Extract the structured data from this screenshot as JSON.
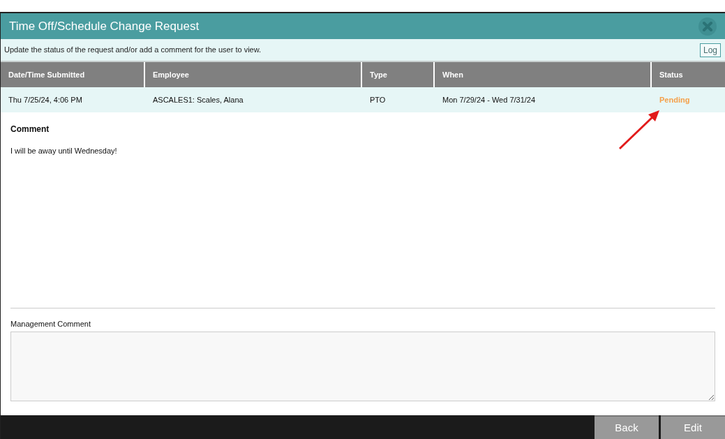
{
  "window": {
    "title": "Time Off/Schedule Change Request"
  },
  "instructions": "Update the status of the request and/or add a comment for the user to view.",
  "log_button": "Log",
  "table": {
    "columns": [
      "Date/Time Submitted",
      "Employee",
      "Type",
      "When",
      "Status"
    ],
    "rows": [
      {
        "cells": [
          "Thu 7/25/24, 4:06 PM",
          "ASCALES1: Scales, Alana",
          "PTO",
          "Mon 7/29/24 - Wed 7/31/24",
          "Pending"
        ]
      }
    ]
  },
  "comment": {
    "heading": "Comment",
    "text": "I will be away until Wednesday!"
  },
  "management_comment": {
    "label": "Management Comment"
  },
  "buttons": [
    "Back",
    "Edit"
  ]
}
